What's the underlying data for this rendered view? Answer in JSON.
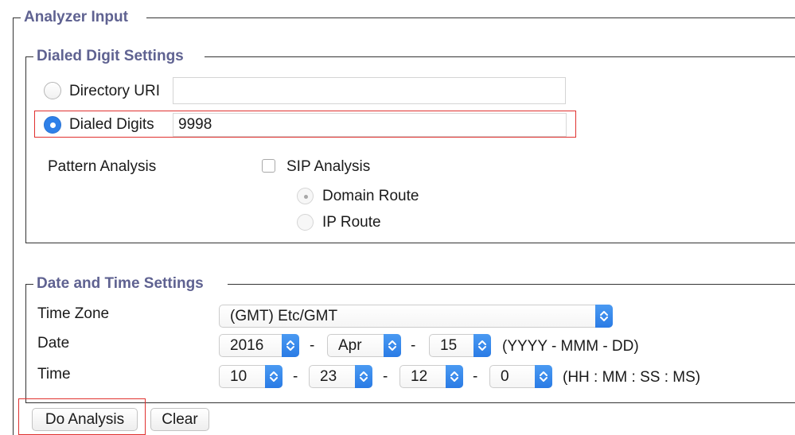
{
  "analyzer_input": {
    "legend": "Analyzer Input"
  },
  "dialed_digit_settings": {
    "legend": "Dialed Digit Settings",
    "directory_uri": {
      "label": "Directory URI",
      "value": "",
      "selected": false
    },
    "dialed_digits": {
      "label": "Dialed Digits",
      "value": "9998",
      "selected": true
    },
    "pattern_analysis_label": "Pattern Analysis",
    "sip_analysis": {
      "label": "SIP Analysis",
      "checked": false
    },
    "domain_route": {
      "label": "Domain Route",
      "selected": true,
      "disabled": true
    },
    "ip_route": {
      "label": "IP Route",
      "selected": false,
      "disabled": true
    }
  },
  "date_time_settings": {
    "legend": "Date and Time Settings",
    "time_zone": {
      "label": "Time Zone",
      "value": "(GMT) Etc/GMT"
    },
    "date": {
      "label": "Date",
      "year": "2016",
      "month": "Apr",
      "day": "15",
      "separator": "-",
      "format_hint": "(YYYY - MMM - DD)"
    },
    "time": {
      "label": "Time",
      "hour": "10",
      "minute": "23",
      "second": "12",
      "millisecond": "0",
      "separator": "-",
      "format_hint": "(HH : MM : SS : MS)"
    }
  },
  "actions": {
    "do_analysis_label": "Do Analysis",
    "clear_label": "Clear"
  },
  "colors": {
    "legend_text": "#5f6291",
    "highlight_border": "#e0312f",
    "radio_selected": "#2f80e8",
    "select_arrow": "#2a7be5"
  }
}
